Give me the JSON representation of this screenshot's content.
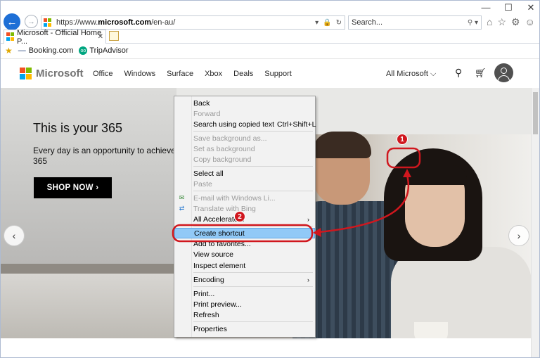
{
  "browser": {
    "url_prefix": "https://www.",
    "url_domain": "microsoft.com",
    "url_path": "/en-au/",
    "search_placeholder": "Search...",
    "tab_title": "Microsoft - Official Home P...",
    "favorites": [
      "Booking.com",
      "TripAdvisor"
    ]
  },
  "site": {
    "brand": "Microsoft",
    "nav": [
      "Office",
      "Windows",
      "Surface",
      "Xbox",
      "Deals",
      "Support"
    ],
    "all_microsoft": "All Microsoft ⌵"
  },
  "hero": {
    "title": "This is your 365",
    "subtitle_line1": "Every day is an opportunity to achieve w",
    "subtitle_line2": "365",
    "cta": "SHOP NOW ›"
  },
  "context_menu": {
    "items": [
      {
        "label": "Back",
        "enabled": true
      },
      {
        "label": "Forward",
        "enabled": false
      },
      {
        "label": "Search using copied text",
        "shortcut": "Ctrl+Shift+L",
        "enabled": true
      },
      {
        "label": "Save background as...",
        "enabled": false
      },
      {
        "label": "Set as background",
        "enabled": false
      },
      {
        "label": "Copy background",
        "enabled": false
      },
      {
        "label": "Select all",
        "enabled": true
      },
      {
        "label": "Paste",
        "enabled": false
      },
      {
        "label": "E-mail with Windows Li...",
        "enabled": false
      },
      {
        "label": "Translate with Bing",
        "enabled": false
      },
      {
        "label": "All Accelerators",
        "enabled": true
      },
      {
        "label": "Create shortcut",
        "enabled": true,
        "highlighted": true
      },
      {
        "label": "Add to favorites...",
        "enabled": true
      },
      {
        "label": "View source",
        "enabled": true
      },
      {
        "label": "Inspect element",
        "enabled": true
      },
      {
        "label": "Encoding",
        "enabled": true
      },
      {
        "label": "Print...",
        "enabled": true
      },
      {
        "label": "Print preview...",
        "enabled": true
      },
      {
        "label": "Refresh",
        "enabled": true
      },
      {
        "label": "Properties",
        "enabled": true
      }
    ]
  },
  "annotations": {
    "step1": "1",
    "step2": "2"
  },
  "colors": {
    "accent_red": "#d0171e",
    "highlight_blue": "#91c9f7",
    "ms_red": "#f25022",
    "ms_green": "#7fba00",
    "ms_blue": "#00a4ef",
    "ms_yellow": "#ffb900"
  }
}
